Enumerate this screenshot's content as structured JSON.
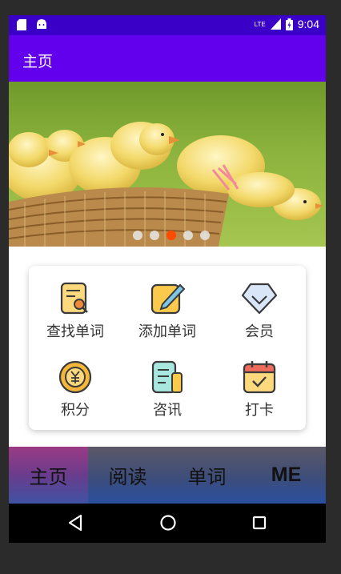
{
  "status_bar": {
    "network": "LTE",
    "time": "9:04"
  },
  "app_bar": {
    "title": "主页"
  },
  "banner": {
    "image": "yellow chicks in a wicker basket",
    "dots": 5,
    "active_dot": 3
  },
  "menu": {
    "items": [
      {
        "label": "查找单词",
        "icon": "search-word-icon"
      },
      {
        "label": "添加单词",
        "icon": "add-word-icon"
      },
      {
        "label": "会员",
        "icon": "vip-diamond-icon"
      },
      {
        "label": "积分",
        "icon": "points-coin-icon"
      },
      {
        "label": "咨讯",
        "icon": "news-icon"
      },
      {
        "label": "打卡",
        "icon": "checkin-calendar-icon"
      }
    ]
  },
  "tabs": [
    {
      "label": "主页",
      "active": true
    },
    {
      "label": "阅读",
      "active": false
    },
    {
      "label": "单词",
      "active": false
    },
    {
      "label": "ME",
      "active": false
    }
  ],
  "colors": {
    "status_bar": "#3a00c8",
    "app_bar": "#6200ee",
    "dot_active": "#ff4a00"
  }
}
